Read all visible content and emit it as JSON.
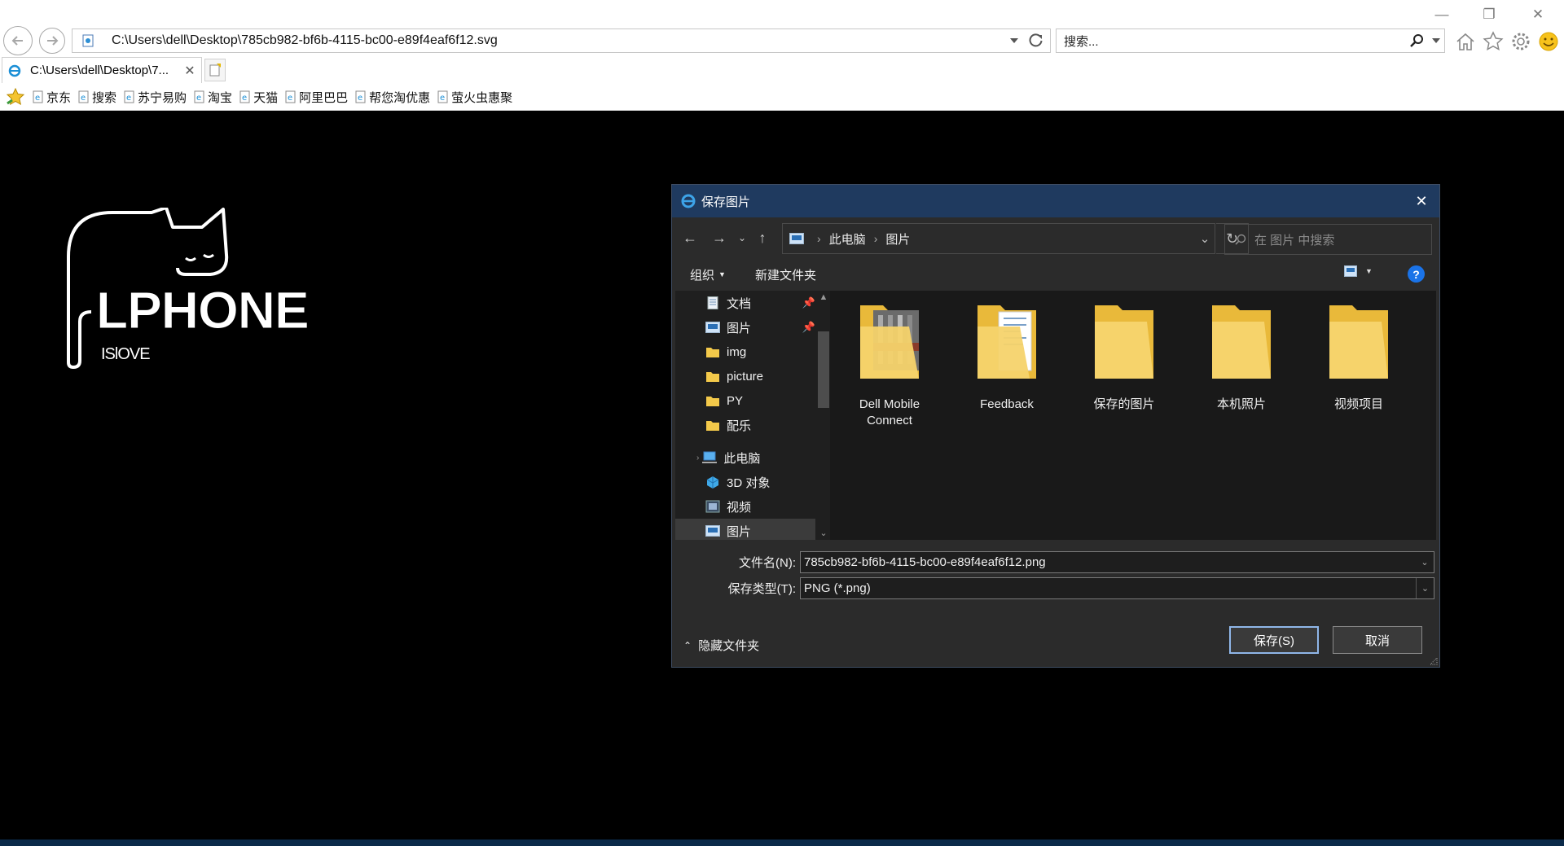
{
  "browser": {
    "address": "C:\\Users\\dell\\Desktop\\785cb982-bf6b-4115-bc00-e89f4eaf6f12.svg",
    "search_placeholder": "搜索...",
    "tab_title": "C:\\Users\\dell\\Desktop\\7...",
    "favorites": [
      "京东",
      "搜索",
      "苏宁易购",
      "淘宝",
      "天猫",
      "阿里巴巴",
      "帮您淘优惠",
      "萤火虫惠聚"
    ]
  },
  "page": {
    "logo_text": "LPHONE",
    "logo_sub": "ISlOVE"
  },
  "dialog": {
    "title": "保存图片",
    "breadcrumb": [
      "此电脑",
      "图片"
    ],
    "search_placeholder": "在 图片 中搜索",
    "organize": "组织",
    "new_folder": "新建文件夹",
    "tree": [
      {
        "label": "文档",
        "icon": "document-icon",
        "pinned": true
      },
      {
        "label": "图片",
        "icon": "pictures-icon",
        "pinned": true
      },
      {
        "label": "img",
        "icon": "folder-icon"
      },
      {
        "label": "picture",
        "icon": "folder-icon"
      },
      {
        "label": "PY",
        "icon": "folder-icon"
      },
      {
        "label": "配乐",
        "icon": "folder-icon"
      },
      {
        "label": "此电脑",
        "icon": "computer-icon"
      },
      {
        "label": "3D 对象",
        "icon": "3d-objects-icon"
      },
      {
        "label": "视频",
        "icon": "videos-icon"
      },
      {
        "label": "图片",
        "icon": "pictures-icon",
        "selected": true
      }
    ],
    "files": [
      {
        "name": "Dell Mobile Connect",
        "thumb": "photo"
      },
      {
        "name": "Feedback",
        "thumb": "docs"
      },
      {
        "name": "保存的图片",
        "thumb": "plain"
      },
      {
        "name": "本机照片",
        "thumb": "plain"
      },
      {
        "name": "视频项目",
        "thumb": "plain"
      }
    ],
    "filename_label": "文件名(N):",
    "filename_value": "785cb982-bf6b-4115-bc00-e89f4eaf6f12.png",
    "filetype_label": "保存类型(T):",
    "filetype_value": "PNG (*.png)",
    "hide_folders": "隐藏文件夹",
    "save": "保存(S)",
    "cancel": "取消"
  }
}
